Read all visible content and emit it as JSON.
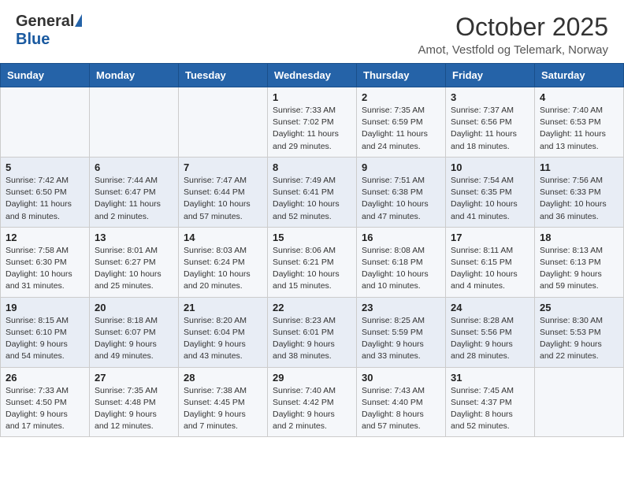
{
  "header": {
    "logo_general": "General",
    "logo_blue": "Blue",
    "month_title": "October 2025",
    "location": "Amot, Vestfold og Telemark, Norway"
  },
  "days_of_week": [
    "Sunday",
    "Monday",
    "Tuesday",
    "Wednesday",
    "Thursday",
    "Friday",
    "Saturday"
  ],
  "weeks": [
    [
      {
        "day": "",
        "info": ""
      },
      {
        "day": "",
        "info": ""
      },
      {
        "day": "",
        "info": ""
      },
      {
        "day": "1",
        "info": "Sunrise: 7:33 AM\nSunset: 7:02 PM\nDaylight: 11 hours\nand 29 minutes."
      },
      {
        "day": "2",
        "info": "Sunrise: 7:35 AM\nSunset: 6:59 PM\nDaylight: 11 hours\nand 24 minutes."
      },
      {
        "day": "3",
        "info": "Sunrise: 7:37 AM\nSunset: 6:56 PM\nDaylight: 11 hours\nand 18 minutes."
      },
      {
        "day": "4",
        "info": "Sunrise: 7:40 AM\nSunset: 6:53 PM\nDaylight: 11 hours\nand 13 minutes."
      }
    ],
    [
      {
        "day": "5",
        "info": "Sunrise: 7:42 AM\nSunset: 6:50 PM\nDaylight: 11 hours\nand 8 minutes."
      },
      {
        "day": "6",
        "info": "Sunrise: 7:44 AM\nSunset: 6:47 PM\nDaylight: 11 hours\nand 2 minutes."
      },
      {
        "day": "7",
        "info": "Sunrise: 7:47 AM\nSunset: 6:44 PM\nDaylight: 10 hours\nand 57 minutes."
      },
      {
        "day": "8",
        "info": "Sunrise: 7:49 AM\nSunset: 6:41 PM\nDaylight: 10 hours\nand 52 minutes."
      },
      {
        "day": "9",
        "info": "Sunrise: 7:51 AM\nSunset: 6:38 PM\nDaylight: 10 hours\nand 47 minutes."
      },
      {
        "day": "10",
        "info": "Sunrise: 7:54 AM\nSunset: 6:35 PM\nDaylight: 10 hours\nand 41 minutes."
      },
      {
        "day": "11",
        "info": "Sunrise: 7:56 AM\nSunset: 6:33 PM\nDaylight: 10 hours\nand 36 minutes."
      }
    ],
    [
      {
        "day": "12",
        "info": "Sunrise: 7:58 AM\nSunset: 6:30 PM\nDaylight: 10 hours\nand 31 minutes."
      },
      {
        "day": "13",
        "info": "Sunrise: 8:01 AM\nSunset: 6:27 PM\nDaylight: 10 hours\nand 25 minutes."
      },
      {
        "day": "14",
        "info": "Sunrise: 8:03 AM\nSunset: 6:24 PM\nDaylight: 10 hours\nand 20 minutes."
      },
      {
        "day": "15",
        "info": "Sunrise: 8:06 AM\nSunset: 6:21 PM\nDaylight: 10 hours\nand 15 minutes."
      },
      {
        "day": "16",
        "info": "Sunrise: 8:08 AM\nSunset: 6:18 PM\nDaylight: 10 hours\nand 10 minutes."
      },
      {
        "day": "17",
        "info": "Sunrise: 8:11 AM\nSunset: 6:15 PM\nDaylight: 10 hours\nand 4 minutes."
      },
      {
        "day": "18",
        "info": "Sunrise: 8:13 AM\nSunset: 6:13 PM\nDaylight: 9 hours\nand 59 minutes."
      }
    ],
    [
      {
        "day": "19",
        "info": "Sunrise: 8:15 AM\nSunset: 6:10 PM\nDaylight: 9 hours\nand 54 minutes."
      },
      {
        "day": "20",
        "info": "Sunrise: 8:18 AM\nSunset: 6:07 PM\nDaylight: 9 hours\nand 49 minutes."
      },
      {
        "day": "21",
        "info": "Sunrise: 8:20 AM\nSunset: 6:04 PM\nDaylight: 9 hours\nand 43 minutes."
      },
      {
        "day": "22",
        "info": "Sunrise: 8:23 AM\nSunset: 6:01 PM\nDaylight: 9 hours\nand 38 minutes."
      },
      {
        "day": "23",
        "info": "Sunrise: 8:25 AM\nSunset: 5:59 PM\nDaylight: 9 hours\nand 33 minutes."
      },
      {
        "day": "24",
        "info": "Sunrise: 8:28 AM\nSunset: 5:56 PM\nDaylight: 9 hours\nand 28 minutes."
      },
      {
        "day": "25",
        "info": "Sunrise: 8:30 AM\nSunset: 5:53 PM\nDaylight: 9 hours\nand 22 minutes."
      }
    ],
    [
      {
        "day": "26",
        "info": "Sunrise: 7:33 AM\nSunset: 4:50 PM\nDaylight: 9 hours\nand 17 minutes."
      },
      {
        "day": "27",
        "info": "Sunrise: 7:35 AM\nSunset: 4:48 PM\nDaylight: 9 hours\nand 12 minutes."
      },
      {
        "day": "28",
        "info": "Sunrise: 7:38 AM\nSunset: 4:45 PM\nDaylight: 9 hours\nand 7 minutes."
      },
      {
        "day": "29",
        "info": "Sunrise: 7:40 AM\nSunset: 4:42 PM\nDaylight: 9 hours\nand 2 minutes."
      },
      {
        "day": "30",
        "info": "Sunrise: 7:43 AM\nSunset: 4:40 PM\nDaylight: 8 hours\nand 57 minutes."
      },
      {
        "day": "31",
        "info": "Sunrise: 7:45 AM\nSunset: 4:37 PM\nDaylight: 8 hours\nand 52 minutes."
      },
      {
        "day": "",
        "info": ""
      }
    ]
  ]
}
